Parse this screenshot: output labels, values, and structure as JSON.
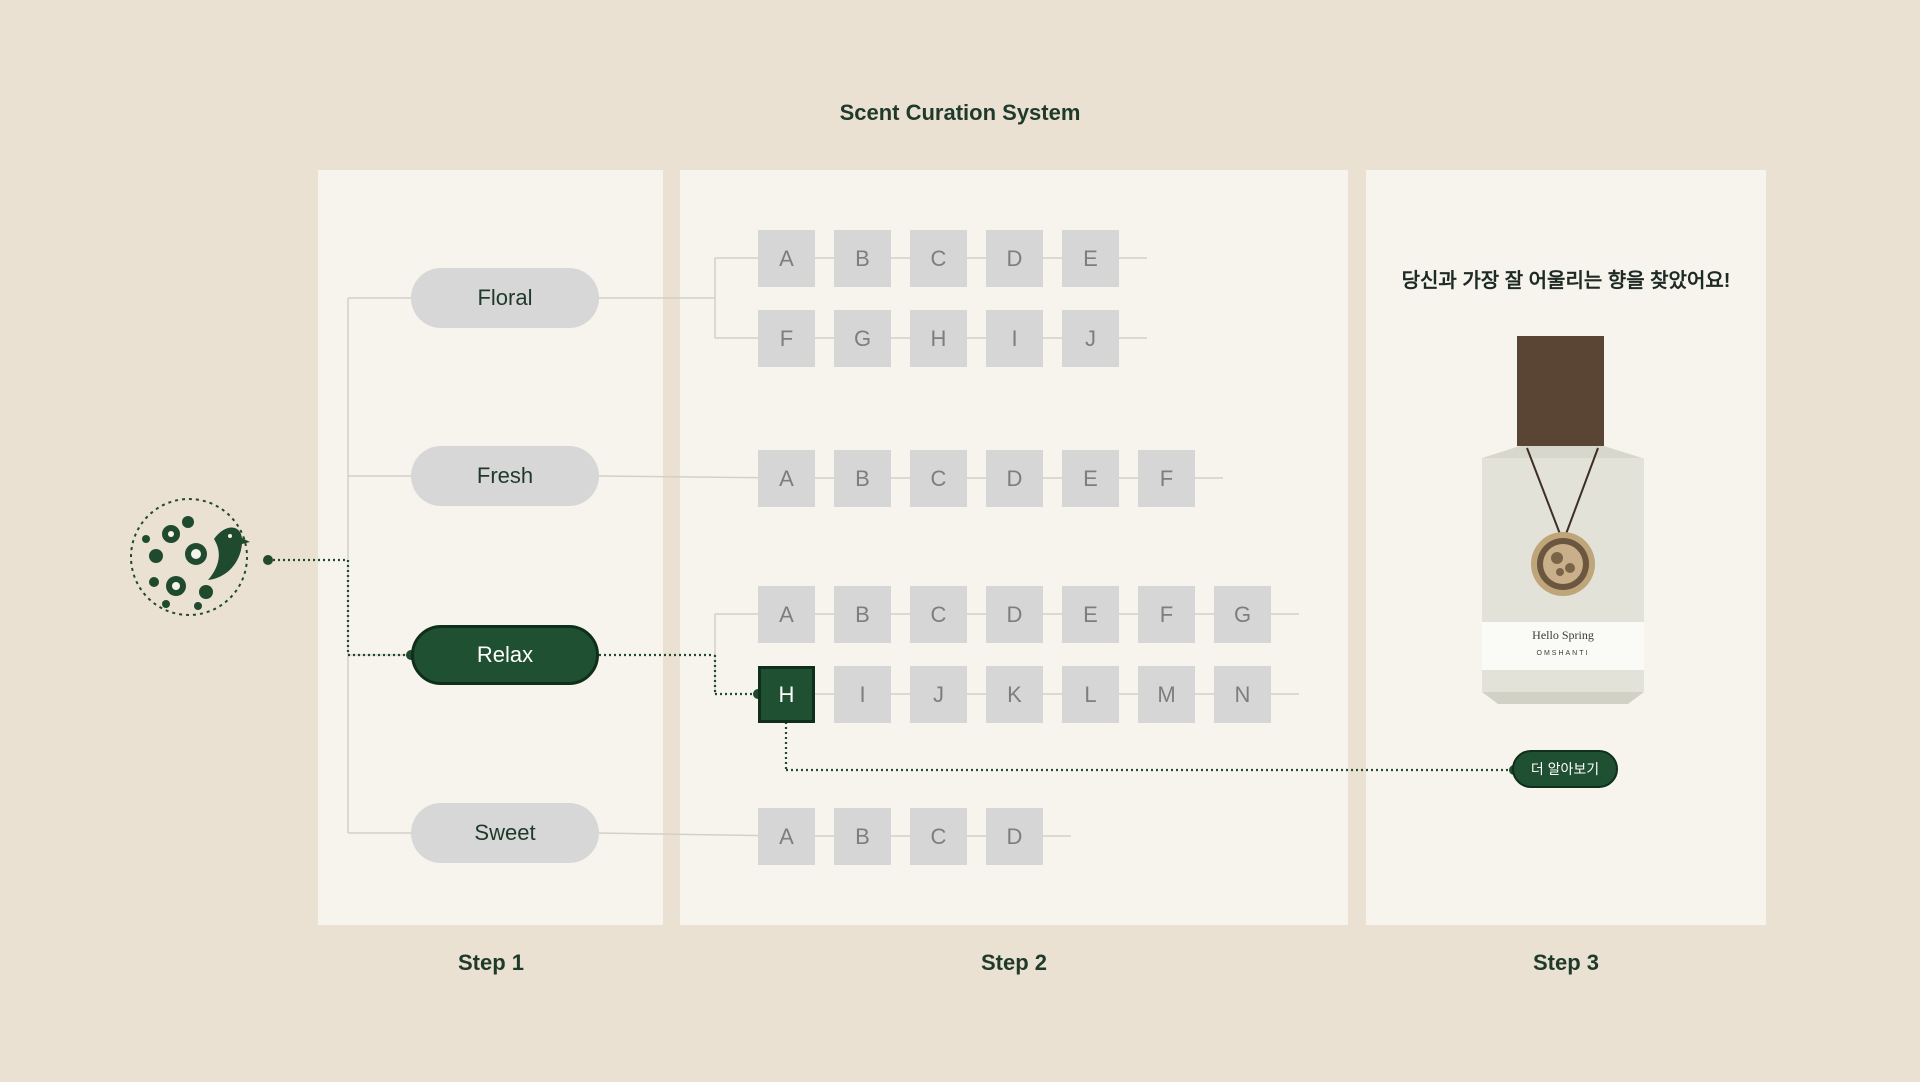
{
  "title": "Scent Curation System",
  "steps": [
    "Step 1",
    "Step 2",
    "Step 3"
  ],
  "categories": [
    {
      "label": "Floral",
      "selected": false,
      "rows": [
        [
          "A",
          "B",
          "C",
          "D",
          "E"
        ],
        [
          "F",
          "G",
          "H",
          "I",
          "J"
        ]
      ]
    },
    {
      "label": "Fresh",
      "selected": false,
      "rows": [
        [
          "A",
          "B",
          "C",
          "D",
          "E",
          "F"
        ]
      ]
    },
    {
      "label": "Relax",
      "selected": true,
      "rows": [
        [
          "A",
          "B",
          "C",
          "D",
          "E",
          "F",
          "G"
        ],
        [
          "H",
          "I",
          "J",
          "K",
          "L",
          "M",
          "N"
        ]
      ],
      "selected_item": "H"
    },
    {
      "label": "Sweet",
      "selected": false,
      "rows": [
        [
          "A",
          "B",
          "C",
          "D"
        ]
      ]
    }
  ],
  "result": {
    "heading": "당신과 가장 잘 어울리는 향을 찾았어요!",
    "product_name": "Hello Spring",
    "brand": "OMSHANTI",
    "button_label": "더 알아보기"
  },
  "colors": {
    "background": "#EAE1D3",
    "panel": "#F7F4EE",
    "accent": "#1F5032",
    "chip": "#D6D6D6",
    "bottle_cap": "#5A4535",
    "bottle_body": "#E3E2D8"
  },
  "icons": [
    "floral-bird-logo-icon",
    "medallion-icon"
  ]
}
